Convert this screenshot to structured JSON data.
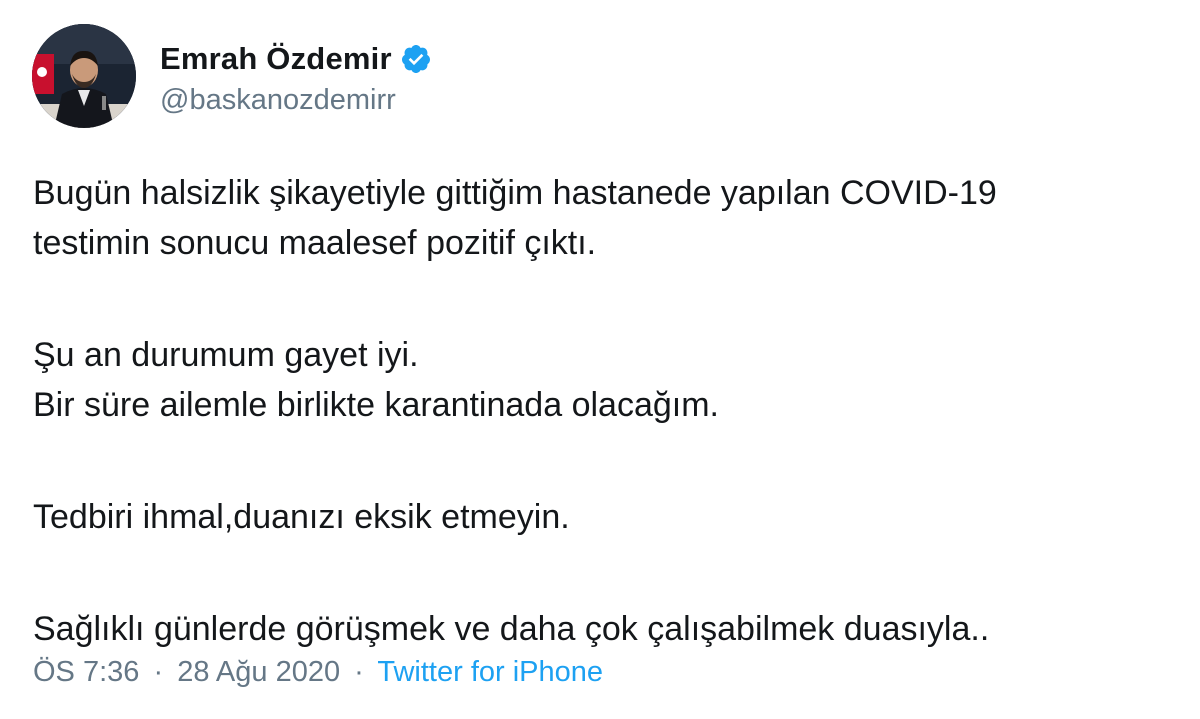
{
  "author": {
    "display_name": "Emrah Özdemir",
    "handle": "@baskanozdemirr",
    "verified": true,
    "verified_icon": "verified-badge-icon",
    "verified_color": "#1da1f2"
  },
  "tweet": {
    "paragraphs": [
      "Bugün halsizlik şikayetiyle gittiğim hastanede yapılan COVID-19",
      "testimin sonucu maalesef pozitif çıktı.",
      "Şu an durumum gayet iyi.",
      "Bir süre ailemle birlikte karantinada olacağım.",
      "Tedbiri ihmal,duanızı eksik etmeyin.",
      "Sağlıklı günlerde görüşmek ve daha çok çalışabilmek duasıyla.."
    ]
  },
  "meta": {
    "time": "ÖS 7:36",
    "separator": "·",
    "date": "28 Ağu 2020",
    "source": "Twitter for iPhone"
  },
  "colors": {
    "text": "#14171a",
    "muted": "#657786",
    "link": "#1da1f2"
  }
}
